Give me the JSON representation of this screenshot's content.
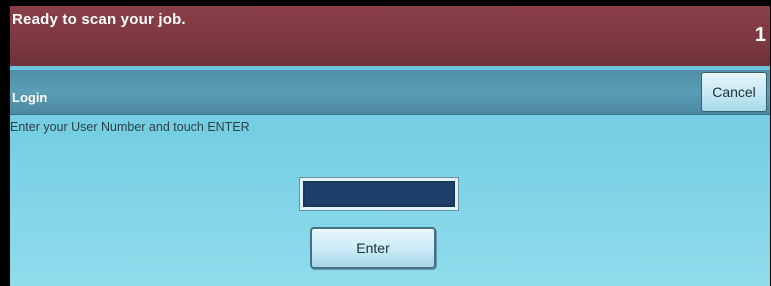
{
  "status_bar": {
    "message": "Ready to scan your job.",
    "job_count": "1"
  },
  "title_bar": {
    "title": "Login",
    "cancel_label": "Cancel"
  },
  "main": {
    "instruction": "Enter your User Number and touch ENTER",
    "user_number_value": "",
    "enter_label": "Enter"
  },
  "colors": {
    "status_bar": "#7d3840",
    "title_bar": "#5a9db5",
    "screen_background": "#74cde2",
    "input_field": "#1f3f6b"
  }
}
